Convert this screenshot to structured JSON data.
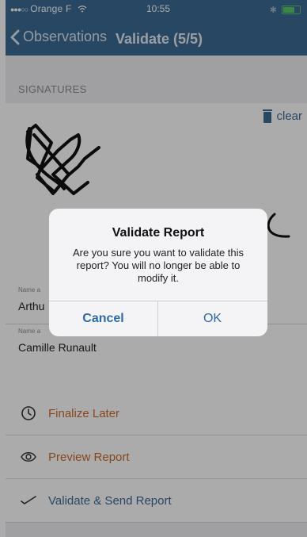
{
  "status_bar": {
    "carrier": "Orange F",
    "time": "10:55"
  },
  "nav": {
    "back_label": "Observations",
    "title": "Validate (5/5)"
  },
  "signatures": {
    "section_label": "SIGNATURES",
    "clear_label": "clear",
    "signers": [
      {
        "field_label": "Name a",
        "name": "Arthu"
      },
      {
        "field_label": "Name a",
        "name": "Camille Runault"
      }
    ]
  },
  "actions": [
    {
      "label": "Finalize Later",
      "icon": "clock-icon",
      "color": "#c96b2d"
    },
    {
      "label": "Preview Report",
      "icon": "eye-icon",
      "color": "#c96b2d"
    },
    {
      "label": "Validate & Send Report",
      "icon": "checkmark-icon",
      "color": "#3d6a93"
    }
  ],
  "dialog": {
    "title": "Validate Report",
    "message": "Are you sure you want to validate this report? You will no longer be able to modify it.",
    "cancel_label": "Cancel",
    "ok_label": "OK"
  },
  "colors": {
    "nav_bar": "#3d6a93",
    "accent_orange": "#c96b2d",
    "accent_blue": "#3d6a93"
  }
}
